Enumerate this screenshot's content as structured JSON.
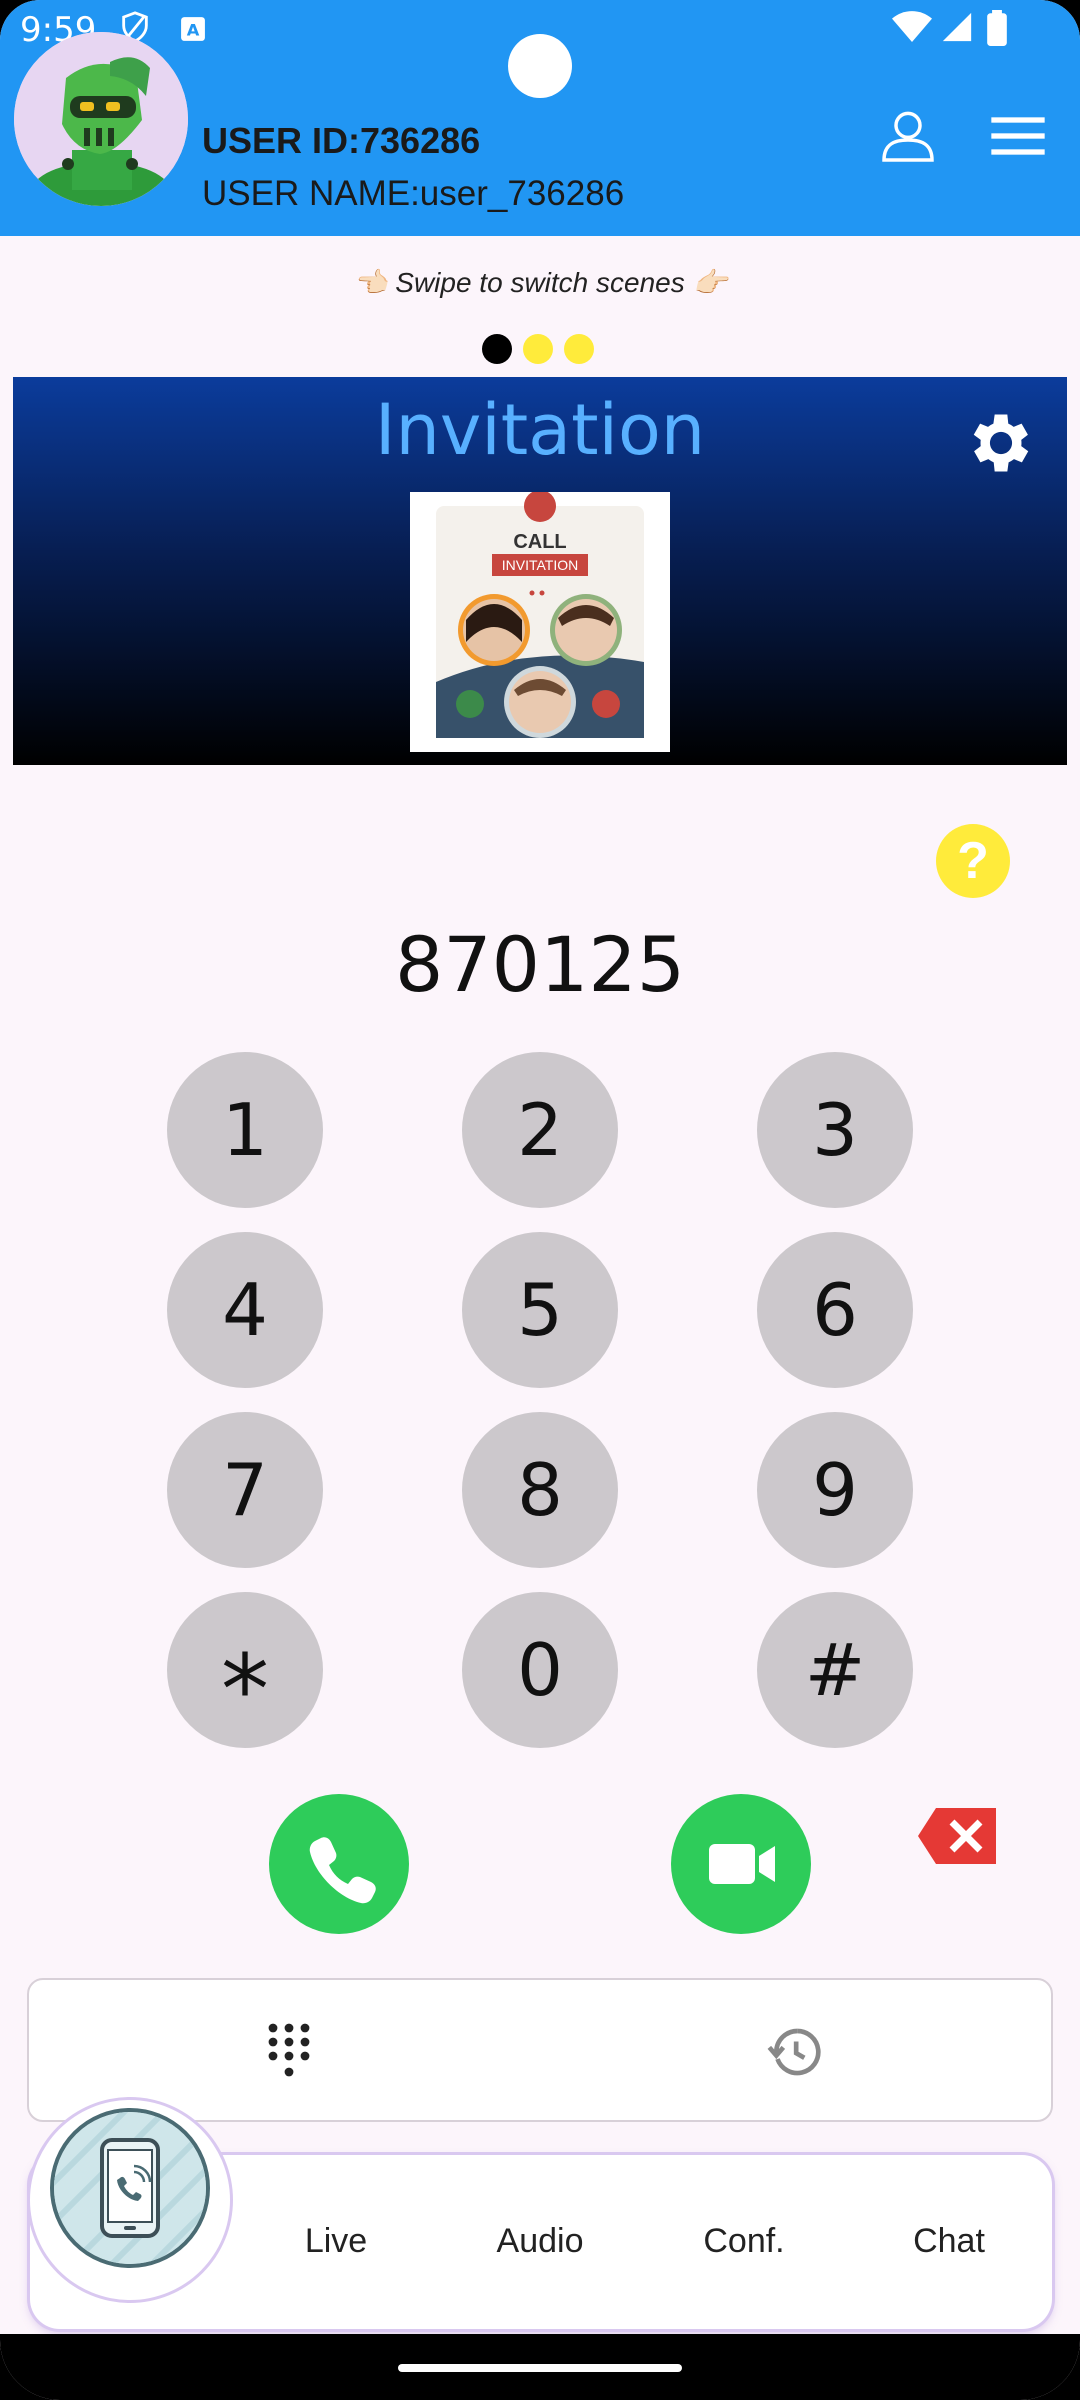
{
  "status_bar": {
    "time": "9:59"
  },
  "header": {
    "user_id": "USER ID:736286",
    "user_name": "USER NAME:user_736286"
  },
  "swipe_hint": "👈🏻 Swipe to switch scenes 👉🏻",
  "scene_dots": {
    "count": 3,
    "active_index": 0,
    "active_color": "#000000",
    "inactive_color": "#ffeb3b"
  },
  "banner": {
    "title": "Invitation",
    "card_title": "CALL",
    "card_subtitle": "INVITATION"
  },
  "help_label": "?",
  "dialer": {
    "number": "870125",
    "keys": [
      "1",
      "2",
      "3",
      "4",
      "5",
      "6",
      "7",
      "8",
      "9",
      "*",
      "0",
      "#"
    ]
  },
  "bottom_nav": {
    "items": [
      "Live",
      "Audio",
      "Conf.",
      "Chat"
    ]
  },
  "colors": {
    "header": "#2196f3",
    "call_green": "#2ecc5a",
    "backspace_red": "#e53935",
    "key_gray": "#ccc8cc",
    "banner_title": "#58b0ff"
  },
  "icons": {
    "phone": "phone-icon",
    "video": "video-camera-icon",
    "backspace": "backspace-icon",
    "settings": "gear-icon",
    "profile": "person-icon",
    "menu": "hamburger-menu-icon",
    "keypad": "dialpad-icon",
    "history": "history-icon"
  }
}
